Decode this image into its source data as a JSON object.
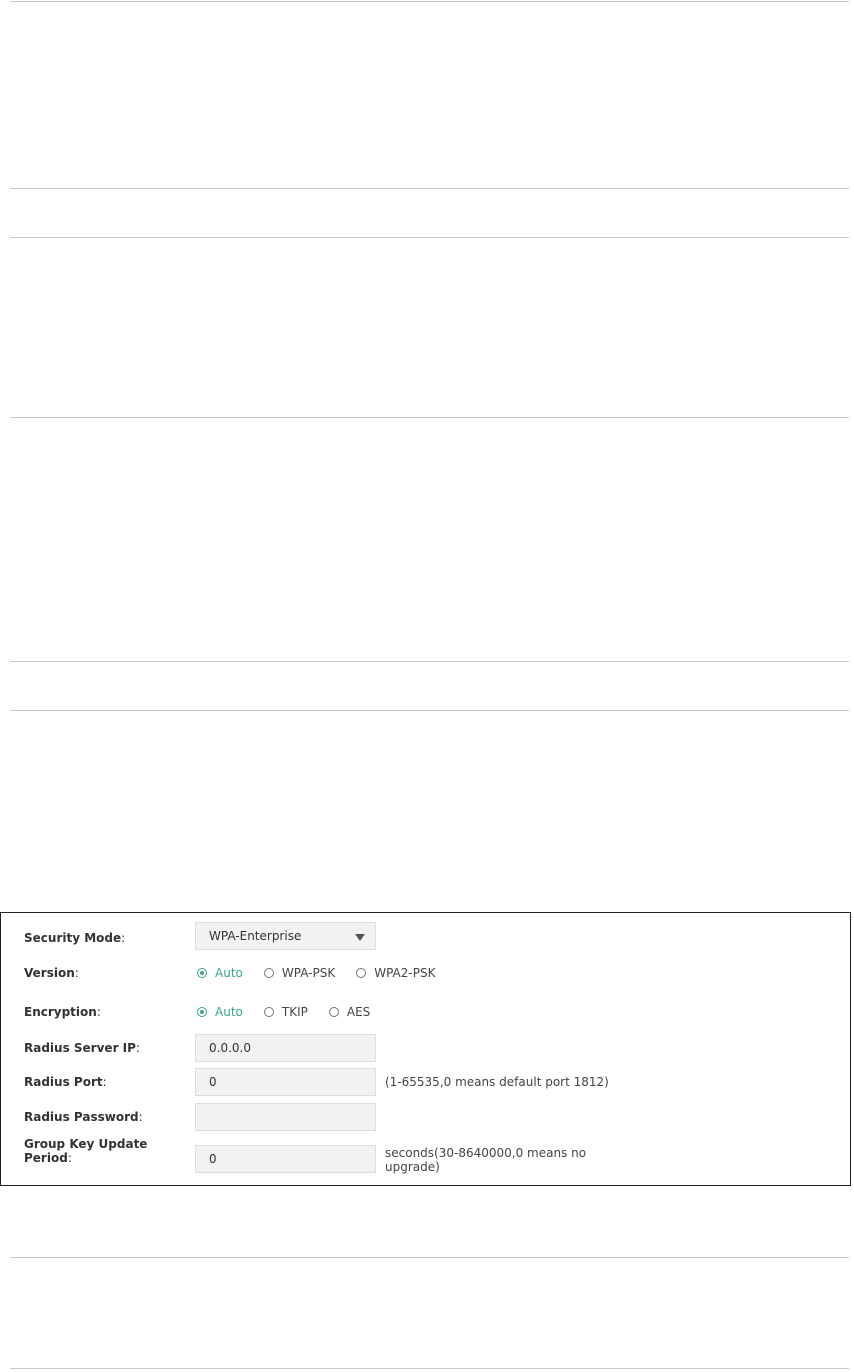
{
  "form": {
    "security_mode": {
      "label": "Security Mode",
      "colon": ":",
      "value": "WPA-Enterprise"
    },
    "version": {
      "label": "Version",
      "colon": ":",
      "options": [
        {
          "label": "Auto",
          "checked": true
        },
        {
          "label": "WPA-PSK",
          "checked": false
        },
        {
          "label": "WPA2-PSK",
          "checked": false
        }
      ]
    },
    "encryption": {
      "label": "Encryption",
      "colon": ":",
      "options": [
        {
          "label": "Auto",
          "checked": true
        },
        {
          "label": "TKIP",
          "checked": false
        },
        {
          "label": "AES",
          "checked": false
        }
      ]
    },
    "radius_server_ip": {
      "label": "Radius Server IP",
      "colon": ":",
      "value": "0.0.0.0"
    },
    "radius_port": {
      "label": "Radius Port",
      "colon": ":",
      "value": "0",
      "hint": "(1-65535,0 means default port 1812)"
    },
    "radius_password": {
      "label": "Radius Password",
      "colon": ":",
      "value": ""
    },
    "group_key_update_period": {
      "label_line1": "Group Key Update",
      "label_line2": "Period",
      "colon": ":",
      "value": "0",
      "hint_line1": "seconds(30-8640000,0 means no",
      "hint_line2": "upgrade)"
    }
  },
  "colors": {
    "accent": "#3aa882",
    "input_bg": "#f2f2f2",
    "rule": "#c8c8c8"
  }
}
